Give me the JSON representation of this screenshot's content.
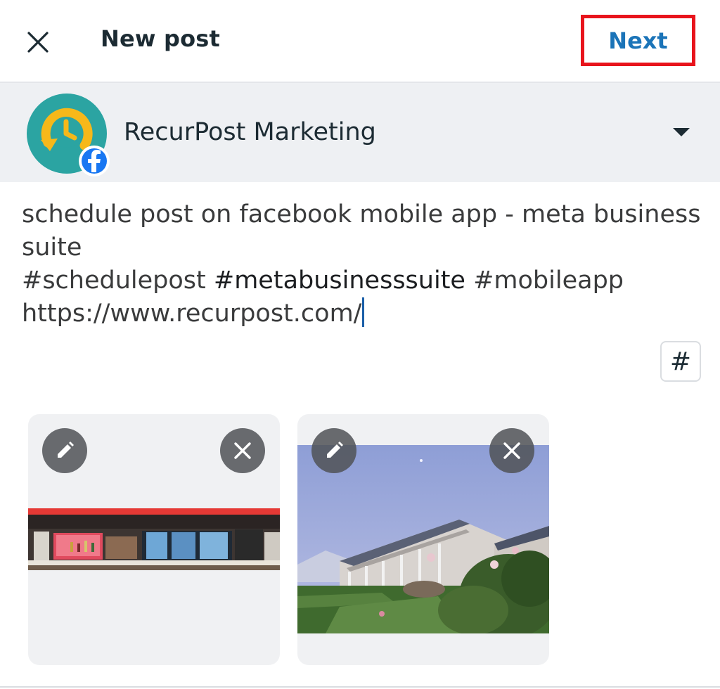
{
  "header": {
    "title": "New post",
    "next_label": "Next"
  },
  "account": {
    "name": "RecurPost Marketing"
  },
  "composer": {
    "line1": "schedule post on facebook mobile app - meta business",
    "line2": "suite",
    "hashtag1": "#schedulepost ",
    "hashtag2": "#metabusinesssuite ",
    "hashtag3": "#mobileapp",
    "url": "https://www.recurpost.com/"
  },
  "hashtag_button": {
    "label": "#"
  },
  "colors": {
    "accent": "#1b74b8",
    "highlight_box": "#e8141c",
    "account_bar": "#eef0f3"
  }
}
